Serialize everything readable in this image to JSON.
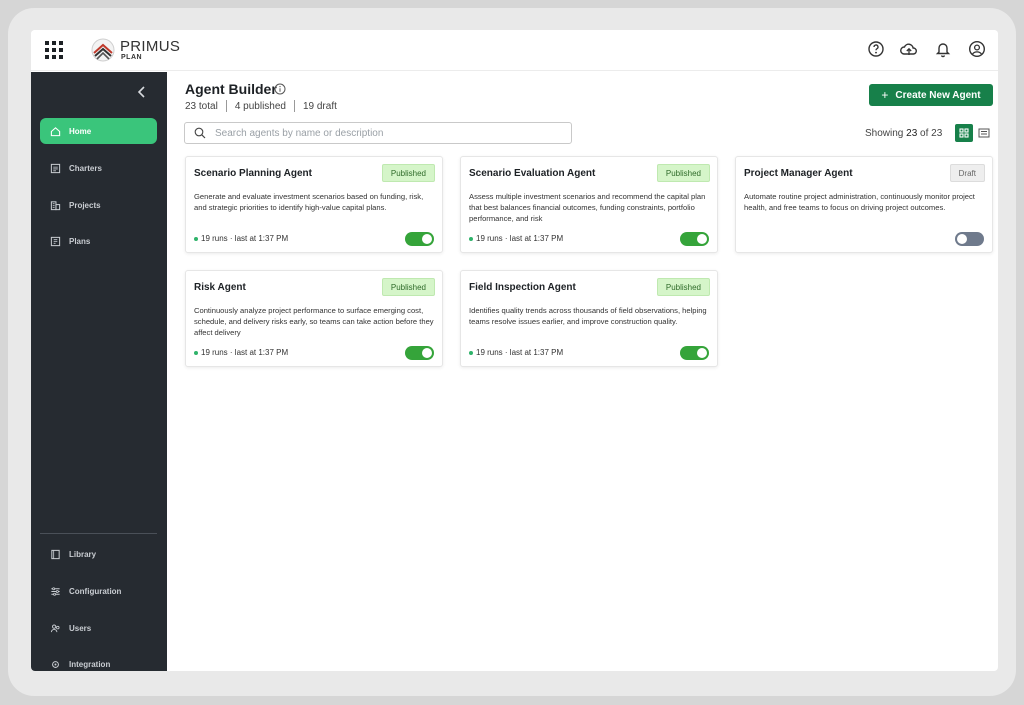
{
  "brand": {
    "name": "PRIMUS",
    "sub": "PLAN"
  },
  "header_icons": [
    "help-icon",
    "cloud-sync-icon",
    "bell-icon",
    "account-icon"
  ],
  "sidebar": {
    "items": [
      {
        "label": "Home",
        "icon": "home-icon",
        "active": true
      },
      {
        "label": "Charters",
        "icon": "document-icon"
      },
      {
        "label": "Projects",
        "icon": "building-icon"
      },
      {
        "label": "Plans",
        "icon": "plan-icon"
      }
    ],
    "bottom_items": [
      {
        "label": "Library",
        "icon": "book-icon"
      },
      {
        "label": "Configuration",
        "icon": "sliders-icon"
      },
      {
        "label": "Users",
        "icon": "users-icon"
      },
      {
        "label": "Integration",
        "icon": "integration-icon"
      }
    ]
  },
  "page": {
    "title": "Agent Builder",
    "stats": {
      "total": "23",
      "total_label": "total",
      "published": "4",
      "published_label": "published",
      "draft": "19",
      "draft_label": "draft"
    },
    "create_label": "Create New Agent",
    "search_placeholder": "Search agents by name or description",
    "showing_prefix": "Showing",
    "showing_count": "23",
    "showing_of": "of",
    "showing_total": "23"
  },
  "agents": [
    {
      "name": "Scenario Planning Agent",
      "status": "Published",
      "description": "Generate and evaluate investment scenarios based on funding, risk, and strategic priorities to identify high-value capital plans.",
      "meta": "19 runs · last at 1:37 PM",
      "enabled": true
    },
    {
      "name": "Scenario Evaluation Agent",
      "status": "Published",
      "description": "Assess multiple investment scenarios and recommend the capital plan that best balances financial outcomes, funding constraints, portfolio performance, and risk",
      "meta": "19 runs · last at 1:37 PM",
      "enabled": true
    },
    {
      "name": "Project Manager Agent",
      "status": "Draft",
      "description": "Automate routine project administration, continuously monitor project health, and free teams to focus on driving project outcomes.",
      "meta": "",
      "enabled": false
    },
    {
      "name": "Risk Agent",
      "status": "Published",
      "description": "Continuously analyze project performance to surface emerging cost, schedule, and delivery risks early, so teams can take action before they affect delivery",
      "meta": "19 runs · last at 1:37 PM",
      "enabled": true
    },
    {
      "name": "Field Inspection Agent",
      "status": "Published",
      "description": "Identifies quality trends across thousands of field observations, helping teams resolve issues earlier, and improve construction quality.",
      "meta": "19 runs · last at 1:37 PM",
      "enabled": true
    }
  ],
  "colors": {
    "accent": "#17804a",
    "sidebar_bg": "#262b31",
    "active_nav": "#3ac57b",
    "published_bg": "#d5f5c9"
  }
}
